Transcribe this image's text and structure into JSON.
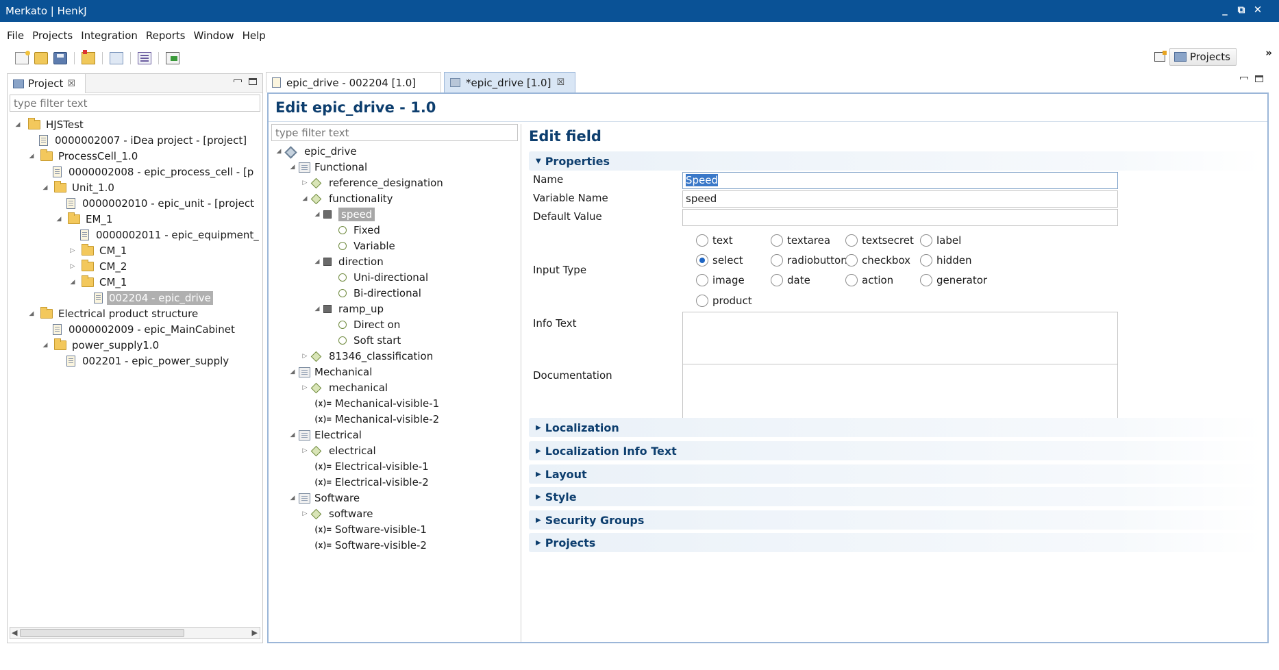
{
  "window": {
    "title": "Merkato | HenkJ"
  },
  "menu": [
    "File",
    "Projects",
    "Integration",
    "Reports",
    "Window",
    "Help"
  ],
  "perspective": {
    "label": "Projects"
  },
  "left_panel": {
    "tab_label": "Project",
    "filter_placeholder": "type filter text",
    "tree": [
      {
        "label": "HJSTest",
        "icon": "folder"
      },
      {
        "label": "0000002007 - iDea project - [project]",
        "icon": "document"
      },
      {
        "label": "ProcessCell_1.0",
        "icon": "folder"
      },
      {
        "label": "0000002008 - epic_process_cell - [p",
        "icon": "document"
      },
      {
        "label": "Unit_1.0",
        "icon": "folder"
      },
      {
        "label": "0000002010 - epic_unit - [project",
        "icon": "document"
      },
      {
        "label": "EM_1",
        "icon": "folder"
      },
      {
        "label": "0000002011 - epic_equipment_",
        "icon": "document"
      },
      {
        "label": "CM_1",
        "icon": "folder"
      },
      {
        "label": "CM_2",
        "icon": "folder"
      },
      {
        "label": "CM_1",
        "icon": "folder"
      },
      {
        "label": "002204 - epic_drive",
        "icon": "document",
        "selected": true
      },
      {
        "label": "Electrical product structure",
        "icon": "folder"
      },
      {
        "label": "0000002009 - epic_MainCabinet",
        "icon": "document"
      },
      {
        "label": "power_supply1.0",
        "icon": "folder"
      },
      {
        "label": "002201 - epic_power_supply",
        "icon": "document"
      }
    ]
  },
  "editor_tabs": [
    {
      "label": "epic_drive - 002204 [1.0]",
      "active": false
    },
    {
      "label": "*epic_drive [1.0]",
      "active": true
    }
  ],
  "editor": {
    "title": "Edit epic_drive - 1.0",
    "filter_placeholder": "type filter text",
    "tree": [
      {
        "label": "epic_drive",
        "icon": "diamond-root"
      },
      {
        "label": "Functional",
        "icon": "grid"
      },
      {
        "label": "reference_designation",
        "icon": "diamond"
      },
      {
        "label": "functionality",
        "icon": "diamond"
      },
      {
        "label": "speed",
        "icon": "square",
        "selected": true
      },
      {
        "label": "Fixed",
        "icon": "circle"
      },
      {
        "label": "Variable",
        "icon": "circle"
      },
      {
        "label": "direction",
        "icon": "square"
      },
      {
        "label": "Uni-directional",
        "icon": "circle"
      },
      {
        "label": "Bi-directional",
        "icon": "circle"
      },
      {
        "label": "ramp_up",
        "icon": "square"
      },
      {
        "label": "Direct on",
        "icon": "circle"
      },
      {
        "label": "Soft start",
        "icon": "circle"
      },
      {
        "label": "81346_classification",
        "icon": "diamond"
      },
      {
        "label": "Mechanical",
        "icon": "grid"
      },
      {
        "label": "mechanical",
        "icon": "diamond"
      },
      {
        "label": "Mechanical-visible-1",
        "icon": "variable"
      },
      {
        "label": "Mechanical-visible-2",
        "icon": "variable"
      },
      {
        "label": "Electrical",
        "icon": "grid"
      },
      {
        "label": "electrical",
        "icon": "diamond"
      },
      {
        "label": "Electrical-visible-1",
        "icon": "variable"
      },
      {
        "label": "Electrical-visible-2",
        "icon": "variable"
      },
      {
        "label": "Software",
        "icon": "grid"
      },
      {
        "label": "software",
        "icon": "diamond"
      },
      {
        "label": "Software-visible-1",
        "icon": "variable"
      },
      {
        "label": "Software-visible-2",
        "icon": "variable"
      }
    ],
    "var_glyph": "(x)=",
    "form": {
      "title": "Edit field",
      "properties_label": "Properties",
      "name_label": "Name",
      "name_value": "Speed",
      "varname_label": "Variable Name",
      "varname_value": "speed",
      "default_label": "Default Value",
      "default_value": "",
      "input_type_label": "Input Type",
      "input_types": [
        {
          "label": "text",
          "checked": false
        },
        {
          "label": "textarea",
          "checked": false
        },
        {
          "label": "textsecret",
          "checked": false
        },
        {
          "label": "label",
          "checked": false
        },
        {
          "label": "select",
          "checked": true
        },
        {
          "label": "radiobutton",
          "checked": false
        },
        {
          "label": "checkbox",
          "checked": false
        },
        {
          "label": "hidden",
          "checked": false
        },
        {
          "label": "image",
          "checked": false
        },
        {
          "label": "date",
          "checked": false
        },
        {
          "label": "action",
          "checked": false
        },
        {
          "label": "generator",
          "checked": false
        },
        {
          "label": "product",
          "checked": false
        }
      ],
      "info_label": "Info Text",
      "doc_label": "Documentation",
      "sections": [
        "Localization",
        "Localization Info Text",
        "Layout",
        "Style",
        "Security Groups",
        "Projects"
      ]
    }
  },
  "colors": {
    "titlebar": "#0a5296",
    "heading": "#0d3e6e",
    "selection": "#a7a7a7"
  }
}
